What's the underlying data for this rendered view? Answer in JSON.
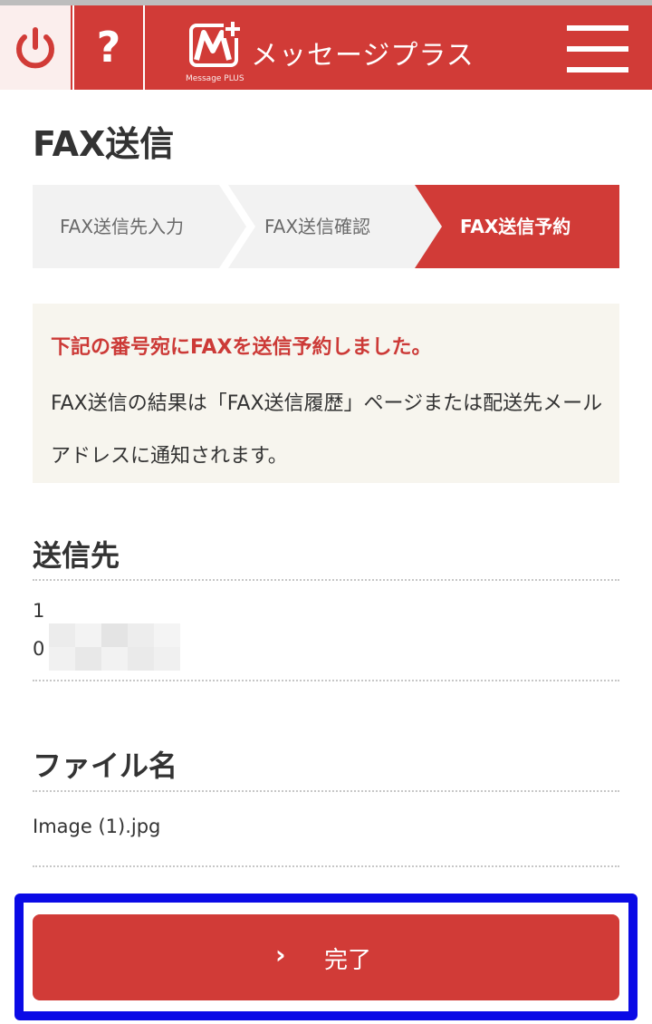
{
  "header": {
    "app_name": "メッセージプラス",
    "logo_subtext": "Message PLUS",
    "help_label": "?",
    "colors": {
      "header_bg": "#d13b37",
      "power_bg": "#fbeeed"
    }
  },
  "page": {
    "title": "FAX送信"
  },
  "steps": [
    {
      "label": "FAX送信先入力",
      "active": false
    },
    {
      "label": "FAX送信確認",
      "active": false
    },
    {
      "label": "FAX送信予約",
      "active": true
    }
  ],
  "notice": {
    "title": "下記の番号宛にFAXを送信予約しました。",
    "body": "FAX送信の結果は「FAX送信履歴」ページまたは配送先メールアドレスに通知されます。"
  },
  "recipient": {
    "section_title": "送信先",
    "line1": "1",
    "line2": "0"
  },
  "file": {
    "section_title": "ファイル名",
    "name": "Image (1).jpg"
  },
  "done_button": {
    "label": "完了",
    "icon": "chevron-right-icon"
  },
  "accent_color": "#d13b37",
  "highlight_color": "#0a0ae6"
}
